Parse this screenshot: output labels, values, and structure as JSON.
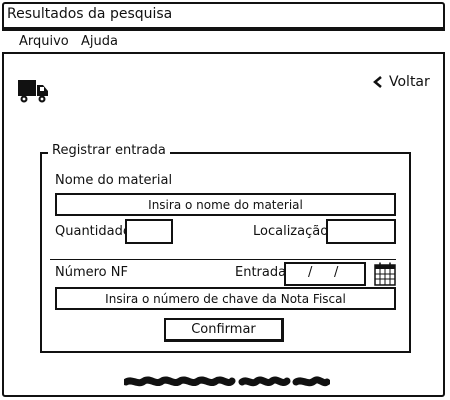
{
  "window": {
    "title": "Resultados da pesquisa"
  },
  "menu": {
    "items": [
      "Arquivo",
      "Ajuda"
    ]
  },
  "nav": {
    "back_label": "Voltar"
  },
  "form": {
    "legend": "Registrar entrada",
    "material_label": "Nome do material",
    "material_placeholder": "Insira o nome do material",
    "quantity_label": "Quantidade",
    "location_label": "Localização",
    "nf_label": "Número NF",
    "entry_label": "Entrada",
    "date_separators": [
      "/",
      "/"
    ],
    "nf_key_placeholder": "Insira o número de chave da Nota Fiscal",
    "confirm_label": "Confirmar"
  },
  "icons": {
    "truck": "truck-icon",
    "back": "chevron-left-icon",
    "calendar": "calendar-icon"
  }
}
